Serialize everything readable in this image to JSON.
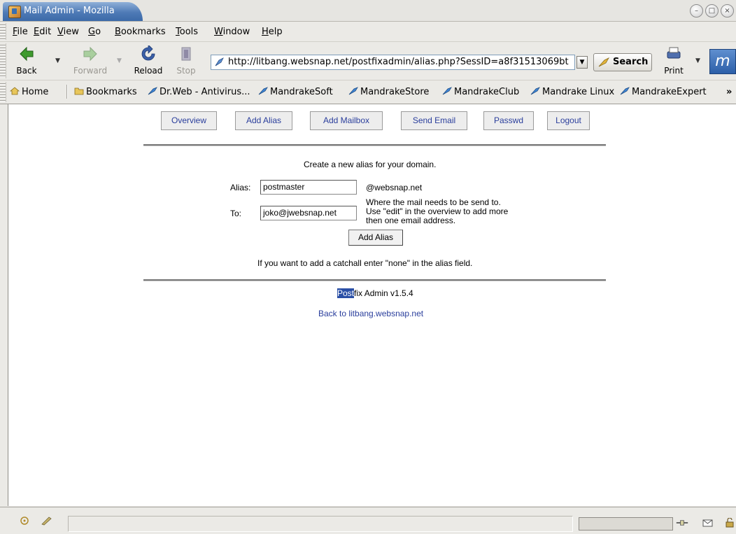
{
  "window": {
    "title": "Mail Admin - Mozilla"
  },
  "menu": [
    "File",
    "Edit",
    "View",
    "Go",
    "Bookmarks",
    "Tools",
    "Window",
    "Help"
  ],
  "menu_mnemonics": [
    "F",
    "E",
    "V",
    "G",
    "B",
    "T",
    "W",
    "H"
  ],
  "nav": {
    "back": "Back",
    "forward": "Forward",
    "reload": "Reload",
    "stop": "Stop",
    "url": "http://litbang.websnap.net/postfixadmin/alias.php?SessID=a8f31513069bt",
    "search": "Search",
    "print": "Print"
  },
  "bookmarks": [
    "Home",
    "Bookmarks",
    "Dr.Web - Antivirus...",
    "MandrakeSoft",
    "MandrakeStore",
    "MandrakeClub",
    "Mandrake Linux",
    "MandrakeExpert"
  ],
  "bookmarks_overflow": "»",
  "page": {
    "tabs": [
      "Overview",
      "Add Alias",
      "Add Mailbox",
      "Send Email",
      "Passwd",
      "Logout"
    ],
    "intro": "Create a new alias for your domain.",
    "alias_label": "Alias:",
    "alias_value": "postmaster",
    "domain_suffix": "@websnap.net",
    "to_label": "To:",
    "to_value": "joko@jwebsnap.net",
    "to_help": [
      "Where the mail needs to be send to.",
      "Use \"edit\" in the overview to add more",
      "then one email address."
    ],
    "submit": "Add Alias",
    "catchall_note": "If you want to add a catchall enter \"none\" in the alias field.",
    "footer_selected": "Post",
    "footer_rest": "fix Admin v1.5.4",
    "back_link": "Back to litbang.websnap.net"
  },
  "colors": {
    "title_tab": "#4e7ab6",
    "link": "#2a3e9c",
    "selection": "#2a4fa6"
  }
}
